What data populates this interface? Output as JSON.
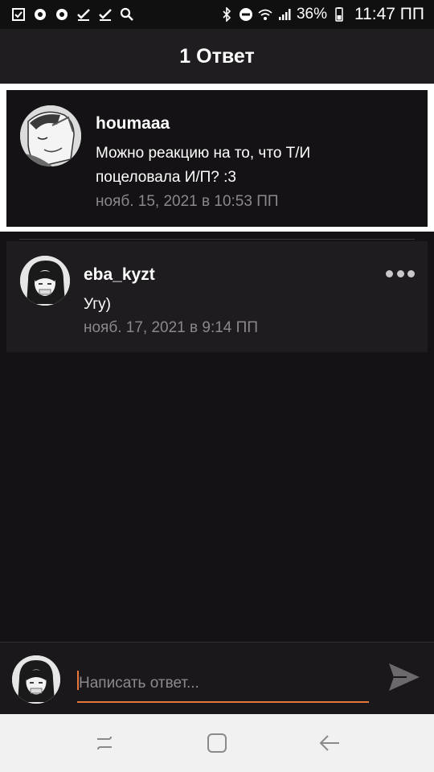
{
  "status_bar": {
    "left_icons": [
      "checkbox-icon",
      "chat-bubble-icon",
      "chat-bubble-icon",
      "checkmark-icon",
      "checkmark-icon",
      "search-icon"
    ],
    "right_icons": [
      "bluetooth-icon",
      "do-not-disturb-icon",
      "wifi-icon",
      "signal-icon",
      "battery-icon"
    ],
    "battery": "36%",
    "time": "11:47 ПП"
  },
  "header": {
    "title": "1 Ответ"
  },
  "parent_comment": {
    "username": "houmaaa",
    "text_line1": "Можно реакцию на то, что Т/И",
    "text_line2": "поцеловала И/П? :3",
    "timestamp": "нояб. 15, 2021 в 10:53 ПП"
  },
  "reply": {
    "username": "eba_kyzt",
    "text": "Угу)",
    "timestamp": "нояб. 17, 2021 в 9:14 ПП"
  },
  "reply_bar": {
    "placeholder": "Написать ответ...",
    "accent_color": "#e8773a"
  },
  "nav_bar": {
    "buttons": [
      "recent-apps-icon",
      "home-icon",
      "back-icon"
    ]
  }
}
